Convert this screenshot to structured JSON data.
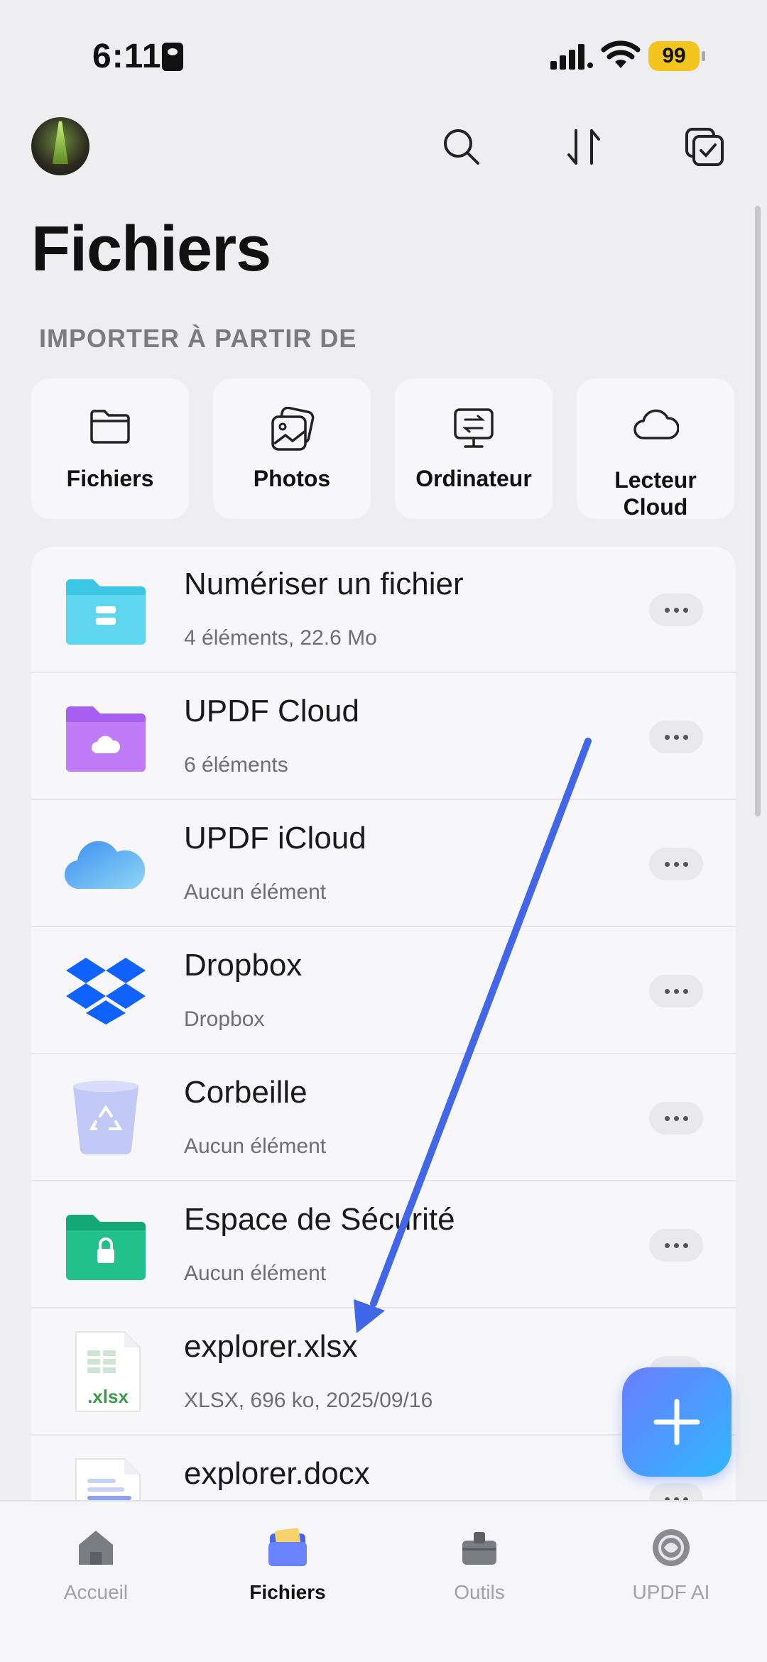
{
  "status_bar": {
    "time": "6:11",
    "battery": "99"
  },
  "header": {
    "title": "Fichiers"
  },
  "import_section": {
    "heading": "IMPORTER À PARTIR DE",
    "items": [
      {
        "label": "Fichiers",
        "icon": "folder-icon"
      },
      {
        "label": "Photos",
        "icon": "photos-icon"
      },
      {
        "label": "Ordinateur",
        "icon": "computer-transfer-icon"
      },
      {
        "label": "Lecteur Cloud",
        "icon": "cloud-icon"
      }
    ]
  },
  "files": [
    {
      "name": "Numériser un fichier",
      "sub": "4 éléments, 22.6 Mo",
      "icon": "scan-folder-icon",
      "color": "#3cc6e6"
    },
    {
      "name": "UPDF Cloud",
      "sub": "6 éléments",
      "icon": "cloud-folder-icon",
      "color": "#b36df5"
    },
    {
      "name": "UPDF iCloud",
      "sub": "Aucun élément",
      "icon": "icloud-icon",
      "color": "#5fb4f2"
    },
    {
      "name": "Dropbox",
      "sub": "Dropbox",
      "icon": "dropbox-icon",
      "color": "#0f62fe"
    },
    {
      "name": "Corbeille",
      "sub": "Aucun élément",
      "icon": "trash-icon",
      "color": "#b7bff5"
    },
    {
      "name": "Espace de Sécurité",
      "sub": "Aucun élément",
      "icon": "secure-folder-icon",
      "color": "#22c08a"
    },
    {
      "name": "explorer.xlsx",
      "sub": "XLSX, 696 ko, 2025/09/16",
      "icon": "xlsx-file-icon",
      "ext": ".xlsx",
      "color": "#3a9a4a"
    },
    {
      "name": "explorer.docx",
      "sub": "",
      "icon": "docx-file-icon",
      "color": "#4a6cf0"
    }
  ],
  "tabbar": {
    "items": [
      {
        "label": "Accueil",
        "icon": "home-icon"
      },
      {
        "label": "Fichiers",
        "icon": "files-tab-icon",
        "active": true
      },
      {
        "label": "Outils",
        "icon": "tools-icon"
      },
      {
        "label": "UPDF AI",
        "icon": "ai-icon"
      }
    ]
  },
  "colors": {
    "accent": "#4a66f0",
    "arrow": "#4266e8",
    "background": "#eeeef1"
  }
}
